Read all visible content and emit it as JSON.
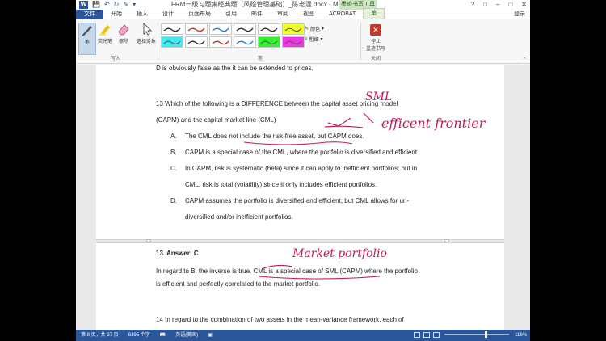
{
  "titlebar": {
    "app_logo": "W",
    "qat_icons": [
      "save-icon",
      "undo-icon",
      "redo-icon",
      "pen-icon",
      "customize-icon"
    ],
    "document_title": "FRM一级习题集经典题（风险管理基础）_陈老湿.docx - Microsoft ...",
    "context_group": "墨迹书写工具",
    "window_controls": [
      "?",
      "□",
      "–",
      "□",
      "✕"
    ]
  },
  "tabs": [
    "文件",
    "开始",
    "插入",
    "设计",
    "页面布局",
    "引用",
    "邮件",
    "审阅",
    "视图",
    "ACROBAT",
    "笔"
  ],
  "login": "登录",
  "ribbon": {
    "write_group": {
      "pen": "笔",
      "highlighter": "荧光笔",
      "eraser": "擦除",
      "select": "选择对象",
      "label": "写入"
    },
    "pens_group_label": "笔",
    "color_label": "颜色",
    "thickness_label": "粗细",
    "stop": {
      "label_line1": "停止",
      "label_line2": "墨迹书写",
      "group_label": "关闭"
    },
    "pen_styles": [
      {
        "kind": "pen",
        "color": "#333333"
      },
      {
        "kind": "pen",
        "color": "#c0392b"
      },
      {
        "kind": "pen",
        "color": "#2e7dd1"
      },
      {
        "kind": "pen",
        "color": "#333333"
      },
      {
        "kind": "pen",
        "color": "#333333"
      },
      {
        "kind": "highlighter",
        "color": "#f2ff22"
      },
      {
        "kind": "highlighter",
        "color": "#3ee9f1"
      },
      {
        "kind": "pen",
        "color": "#333333"
      },
      {
        "kind": "pen",
        "color": "#c0392b"
      },
      {
        "kind": "pen",
        "color": "#2e7dd1"
      },
      {
        "kind": "highlighter",
        "color": "#31f12d"
      },
      {
        "kind": "highlighter",
        "color": "#f135e6"
      }
    ]
  },
  "document": {
    "line0": "D is obviously false as the it can be extended to prices.",
    "q13_line1": "13   Which of the following is a DIFFERENCE between the capital asset pricing model",
    "q13_line2": "(CAPM) and the capital market line (CML)",
    "options": [
      {
        "letter": "A.",
        "text": "The CML does not include the risk-free asset, but CAPM does."
      },
      {
        "letter": "B.",
        "text": "CAPM is a special case of the CML, where the portfolio is diversified and efficient."
      },
      {
        "letter": "C.",
        "text": "In CAPM, risk is systematic (beta) since it can apply to inefficient portfolios; but in"
      },
      {
        "letter": "",
        "text": "CML, risk is total (volatility) since it only includes efficient portfolios."
      },
      {
        "letter": "D.",
        "text": "CAPM assumes the portfolio is diversified and efficient, but CML allows for un-"
      },
      {
        "letter": "",
        "text": "diversified and/or inefficient portfolios."
      }
    ],
    "answer_heading": "13.  Answer: C",
    "answer_line1": "In regard to B, the inverse is true. CML is a special case of SML (CAPM) where the portfolio",
    "answer_line2": "is efficient and perfectly correlated to the market portfolio.",
    "q14_line1": "14   In regard to the combination of two assets in the mean-variance framework, each of"
  },
  "handwriting": {
    "sml": "SML",
    "efficient_frontier": "efficent frontier",
    "market_portfolio": "Market portfolio",
    "ink_color": "#c2185b"
  },
  "statusbar": {
    "page": "第 8 页，共 27 页",
    "words": "6195 个字",
    "language": "英语(美国)",
    "zoom": "116%"
  }
}
